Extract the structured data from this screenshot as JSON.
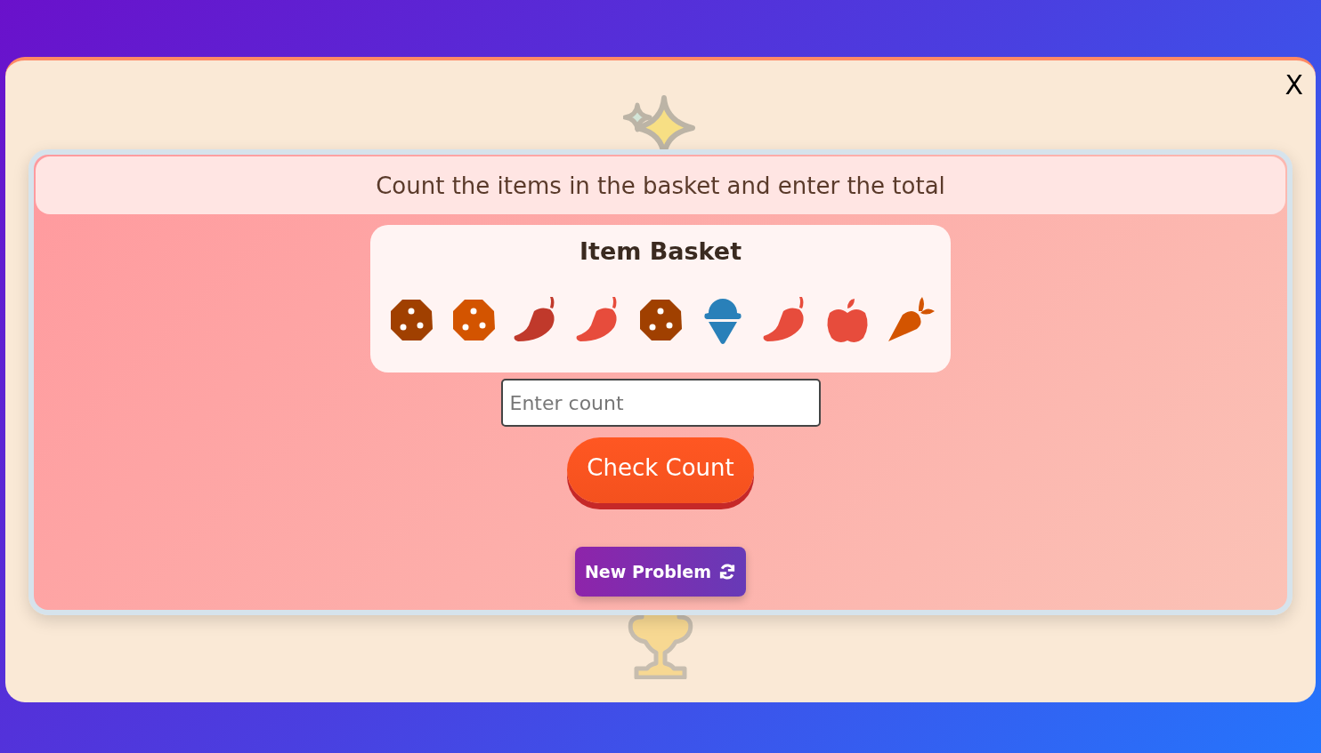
{
  "close_button": {
    "label": "X"
  },
  "instruction": "Count the items in the basket and enter the total",
  "basket": {
    "title": "Item Basket",
    "items": [
      {
        "kind": "cookie",
        "color": "#a04000"
      },
      {
        "kind": "cookie",
        "color": "#d35400"
      },
      {
        "kind": "pepper",
        "color": "#c0392b"
      },
      {
        "kind": "pepper",
        "color": "#e74c3c"
      },
      {
        "kind": "cookie",
        "color": "#a04000"
      },
      {
        "kind": "icecream",
        "color": "#2980b9"
      },
      {
        "kind": "pepper",
        "color": "#e74c3c"
      },
      {
        "kind": "apple",
        "color": "#e74c3c"
      },
      {
        "kind": "carrot",
        "color": "#d35400"
      }
    ]
  },
  "count_field": {
    "placeholder": "Enter count"
  },
  "check_button": {
    "label": "Check Count"
  },
  "new_problem_button": {
    "label": "New Problem"
  }
}
